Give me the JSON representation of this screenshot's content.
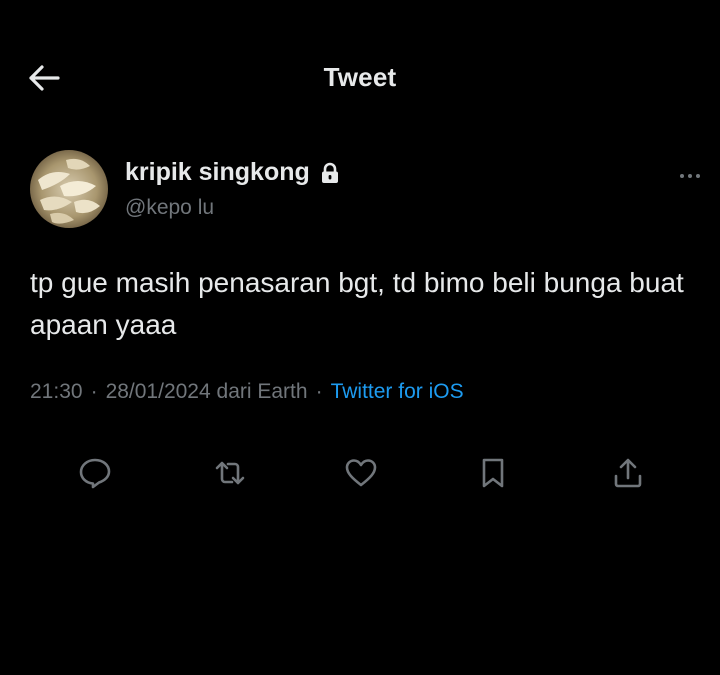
{
  "header": {
    "title": "Tweet",
    "back_icon": "arrow-left-icon"
  },
  "author": {
    "display_name": "kripik singkong",
    "handle": "@kepo lu",
    "protected_icon": "lock-icon",
    "avatar_description": "avatar photo",
    "more_icon": "more-horizontal-icon"
  },
  "tweet": {
    "text": "tp gue masih penasaran bgt, td bimo beli bunga buat apaan yaaa"
  },
  "meta": {
    "time": "21:30",
    "date": "28/01/2024",
    "location": "dari Earth",
    "separator": "·",
    "source": "Twitter for iOS"
  },
  "actions": [
    {
      "name": "reply",
      "icon": "reply-icon"
    },
    {
      "name": "retweet",
      "icon": "retweet-icon"
    },
    {
      "name": "like",
      "icon": "heart-icon"
    },
    {
      "name": "bookmark",
      "icon": "bookmark-icon"
    },
    {
      "name": "share",
      "icon": "share-icon"
    }
  ],
  "colors": {
    "background": "#000000",
    "text_primary": "#e7e9ea",
    "text_secondary": "#71767b",
    "link": "#1d9bf0"
  }
}
